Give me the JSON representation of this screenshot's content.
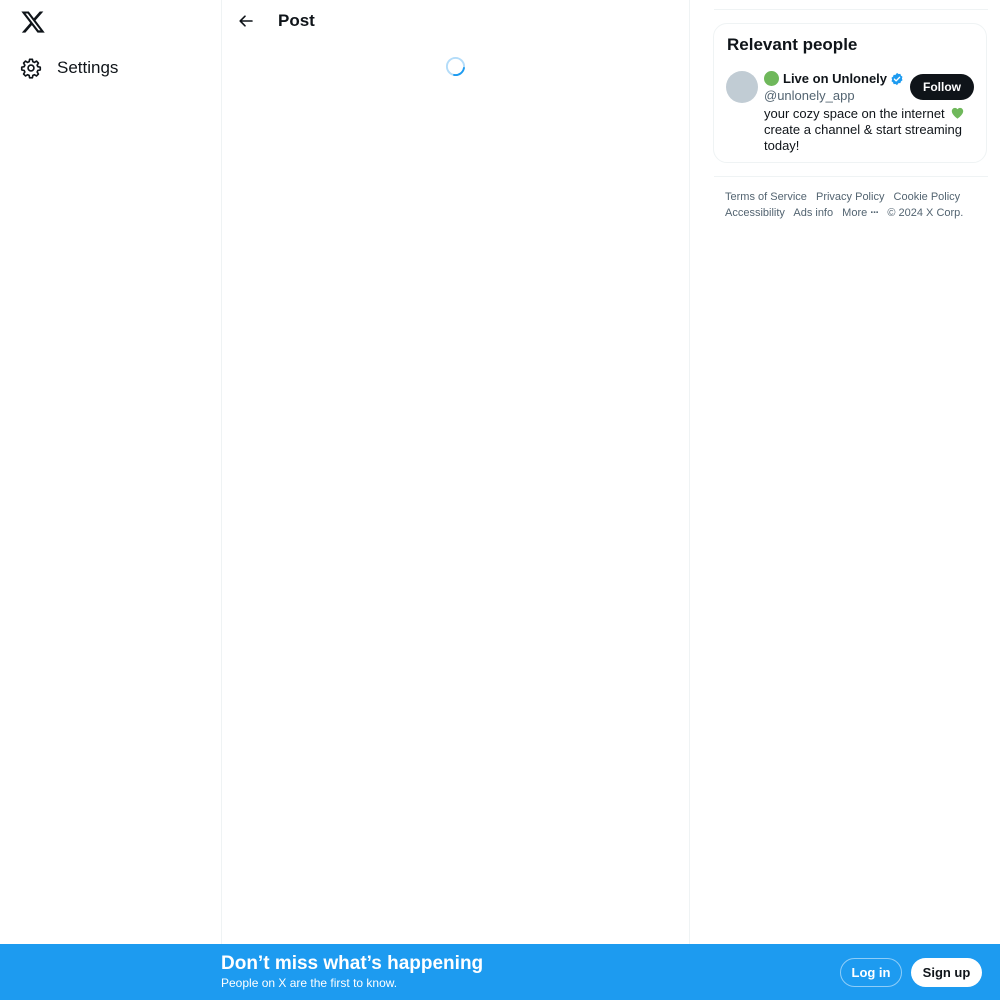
{
  "nav": {
    "logo_icon": "x-logo-icon",
    "settings": {
      "label": "Settings",
      "icon": "gear-icon"
    }
  },
  "main": {
    "back_icon": "arrow-left-icon",
    "title": "Post",
    "loading_icon": "spinner-icon"
  },
  "relevant_people": {
    "title": "Relevant people",
    "person": {
      "name": "Live on Unlonely",
      "name_prefix_icon": "green-circle-icon",
      "verified_icon": "verified-badge-icon",
      "handle": "@unlonely_app",
      "bio_line1": "your cozy space on the internet",
      "bio_line2": "create a channel & start streaming today!",
      "bio_icon": "green-heart-icon",
      "follow_label": "Follow"
    }
  },
  "footer": {
    "links": [
      "Terms of Service",
      "Privacy Policy",
      "Cookie Policy",
      "Accessibility",
      "Ads info",
      "More"
    ],
    "more_icon": "ellipsis-icon",
    "copyright": "© 2024 X Corp."
  },
  "bottom_bar": {
    "title": "Don’t miss what’s happening",
    "subtitle": "People on X are the first to know.",
    "login_label": "Log in",
    "signup_label": "Sign up"
  },
  "colors": {
    "accent": "#1d9bf0",
    "text": "#0f1419",
    "secondary_text": "#536471",
    "border": "#eff3f4"
  }
}
